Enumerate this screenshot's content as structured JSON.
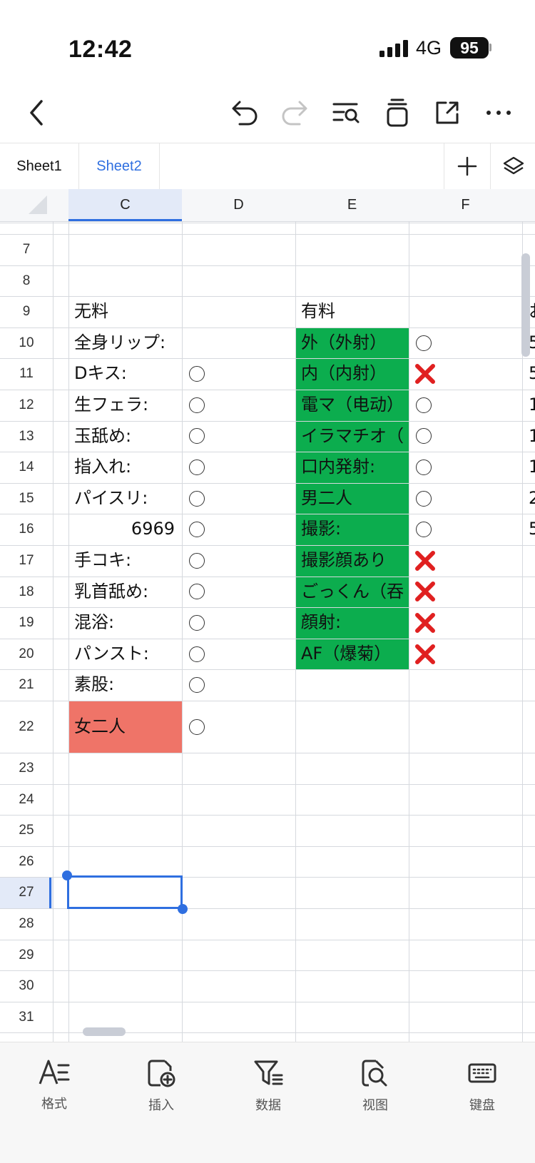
{
  "status_bar": {
    "time": "12:42",
    "network": "4G",
    "battery": "95"
  },
  "tabs": {
    "sheet1": "Sheet1",
    "sheet2": "Sheet2"
  },
  "columns": {
    "c": "C",
    "d": "D",
    "e": "E",
    "f": "F"
  },
  "rows": [
    "7",
    "8",
    "9",
    "10",
    "11",
    "12",
    "13",
    "14",
    "15",
    "16",
    "17",
    "18",
    "19",
    "20",
    "21",
    "22",
    "23",
    "24",
    "25",
    "26",
    "27",
    "28",
    "29",
    "30",
    "31"
  ],
  "free": {
    "header": "无料",
    "items": [
      {
        "label": "全身リップ:",
        "mark": ""
      },
      {
        "label": "Dキス:",
        "mark": "circle"
      },
      {
        "label": "生フェラ:",
        "mark": "circle"
      },
      {
        "label": "玉舐め:",
        "mark": "circle"
      },
      {
        "label": "指入れ:",
        "mark": "circle"
      },
      {
        "label": "パイスリ:",
        "mark": "circle"
      },
      {
        "label": "6969",
        "mark": "circle"
      },
      {
        "label": "手コキ:",
        "mark": "circle"
      },
      {
        "label": "乳首舐め:",
        "mark": "circle"
      },
      {
        "label": "混浴:",
        "mark": "circle"
      },
      {
        "label": "パンスト:",
        "mark": "circle"
      },
      {
        "label": "素股:",
        "mark": "circle"
      },
      {
        "label": "女二人",
        "mark": "circle"
      }
    ]
  },
  "paid": {
    "header": "有料",
    "items": [
      {
        "label": "外（外射）",
        "mark": "circle"
      },
      {
        "label": "内（内射）",
        "mark": "cross"
      },
      {
        "label": "電マ（电动）",
        "mark": "circle"
      },
      {
        "label": "イラマチオ（",
        "mark": "circle"
      },
      {
        "label": "口内発射:",
        "mark": "circle"
      },
      {
        "label": "男二人",
        "mark": "circle"
      },
      {
        "label": "撮影:",
        "mark": "circle"
      },
      {
        "label": "撮影顔あり",
        "mark": "cross"
      },
      {
        "label": "ごっくん（吞",
        "mark": "cross"
      },
      {
        "label": "顔射:",
        "mark": "cross"
      },
      {
        "label": "AF（爆菊）",
        "mark": "cross"
      }
    ]
  },
  "overflow_g": [
    "お",
    "5",
    "5",
    "1",
    "1",
    "1",
    "2",
    "5"
  ],
  "bottom_bar": {
    "format": "格式",
    "insert": "插入",
    "data": "数据",
    "view": "视图",
    "keyboard": "键盘"
  },
  "colors": {
    "green": "#0cad4e",
    "red_cell": "#ef7468",
    "accent": "#2f6fe0",
    "cross": "#e02020"
  },
  "icons": [
    "back-icon",
    "undo-icon",
    "redo-icon",
    "find-icon",
    "clear-icon",
    "share-icon",
    "more-icon",
    "add-sheet-icon",
    "layers-icon",
    "format-icon",
    "insert-icon",
    "filter-icon",
    "view-icon",
    "keyboard-icon"
  ]
}
